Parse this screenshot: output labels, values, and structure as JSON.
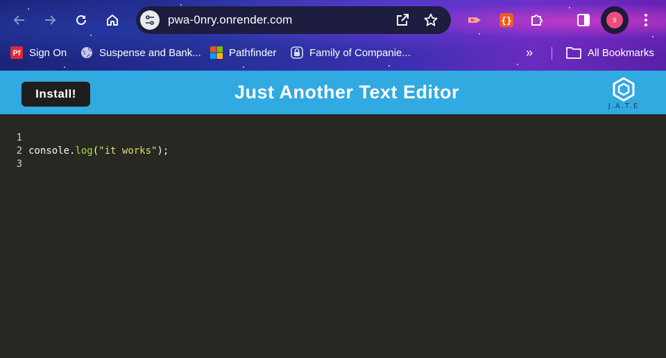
{
  "browser": {
    "url": "pwa-0nry.onrender.com",
    "profile_initial": "s",
    "bookmarks": [
      {
        "label": "Sign On",
        "icon": "pf-icon"
      },
      {
        "label": "Suspense and Bank...",
        "icon": "globe-icon"
      },
      {
        "label": "Pathfinder",
        "icon": "microsoft-icon"
      },
      {
        "label": "Family of Companie...",
        "icon": "lock-badge-icon"
      }
    ],
    "all_bookmarks_label": "All Bookmarks",
    "more_label": "»"
  },
  "app": {
    "install_label": "Install!",
    "title": "Just Another Text Editor",
    "logo_text": "J.A.T.E",
    "header_color": "#31a9e1"
  },
  "editor": {
    "line_numbers": [
      "1",
      "2",
      "3"
    ],
    "line1": {
      "obj": "console.",
      "fn": "log",
      "open": "(",
      "str": "\"it works\"",
      "close": ");"
    },
    "background": "#272822"
  }
}
